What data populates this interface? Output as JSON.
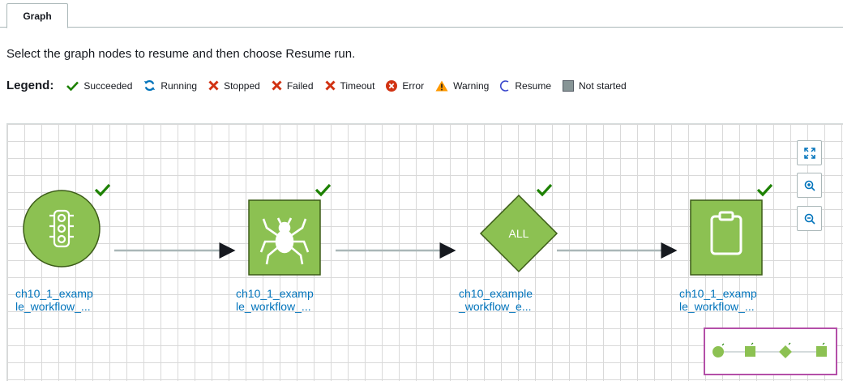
{
  "tabs": [
    {
      "label": "Graph"
    }
  ],
  "instruction": "Select the graph nodes to resume and then choose Resume run.",
  "legend": {
    "title": "Legend:",
    "items": [
      {
        "label": "Succeeded",
        "icon": "check-icon",
        "color": "#1d8102"
      },
      {
        "label": "Running",
        "icon": "refresh-icon",
        "color": "#0073bb"
      },
      {
        "label": "Stopped",
        "icon": "x-icon",
        "color": "#d13212"
      },
      {
        "label": "Failed",
        "icon": "x-icon",
        "color": "#d13212"
      },
      {
        "label": "Timeout",
        "icon": "x-icon",
        "color": "#d13212"
      },
      {
        "label": "Error",
        "icon": "error-circle-icon",
        "color": "#d13212"
      },
      {
        "label": "Warning",
        "icon": "warning-triangle-icon",
        "color": "#ff9900"
      },
      {
        "label": "Resume",
        "icon": "resume-arc-icon",
        "color": "#3b48cc"
      },
      {
        "label": "Not started",
        "icon": "gray-square-icon",
        "color": "#879596"
      }
    ]
  },
  "graph": {
    "node_color": "#8cc152",
    "nodes": [
      {
        "label": "ch10_1_examp\nle_workflow_...",
        "shape": "circle",
        "icon": "traffic-light-icon",
        "status": "Succeeded"
      },
      {
        "label": "ch10_1_examp\nle_workflow_...",
        "shape": "square",
        "icon": "spider-icon",
        "status": "Succeeded"
      },
      {
        "label": "ch10_example\n_workflow_e...",
        "shape": "diamond",
        "text": "ALL",
        "status": "Succeeded"
      },
      {
        "label": "ch10_1_examp\nle_workflow_...",
        "shape": "square",
        "icon": "clipboard-icon",
        "status": "Succeeded"
      }
    ],
    "zoom_controls": [
      {
        "name": "fit",
        "icon": "fit-to-screen-icon"
      },
      {
        "name": "zoom-in",
        "icon": "zoom-in-icon"
      },
      {
        "name": "zoom-out",
        "icon": "zoom-out-icon"
      }
    ]
  }
}
